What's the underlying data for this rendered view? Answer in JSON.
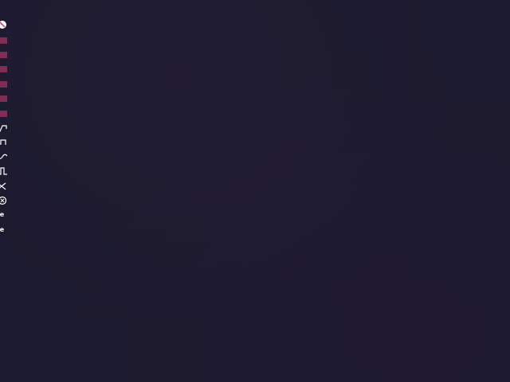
{
  "toolbar": {
    "accent_color": "#e0427a",
    "icon_color": "#ffffff",
    "tools": [
      {
        "icon": "no-entry-icon"
      },
      {
        "icon": "lines-icon"
      },
      {
        "icon": "lines-icon"
      },
      {
        "icon": "lines-icon"
      },
      {
        "icon": "lines-icon"
      },
      {
        "icon": "lines-icon"
      },
      {
        "icon": "lines-icon"
      },
      {
        "icon": "step-curve-icon"
      },
      {
        "icon": "step-curve-icon"
      },
      {
        "icon": "wave-icon"
      },
      {
        "icon": "pulse-icon"
      },
      {
        "icon": "shuffle-icon"
      },
      {
        "icon": "circle-x-icon"
      }
    ],
    "text_items": [
      "ue",
      "ue"
    ]
  }
}
